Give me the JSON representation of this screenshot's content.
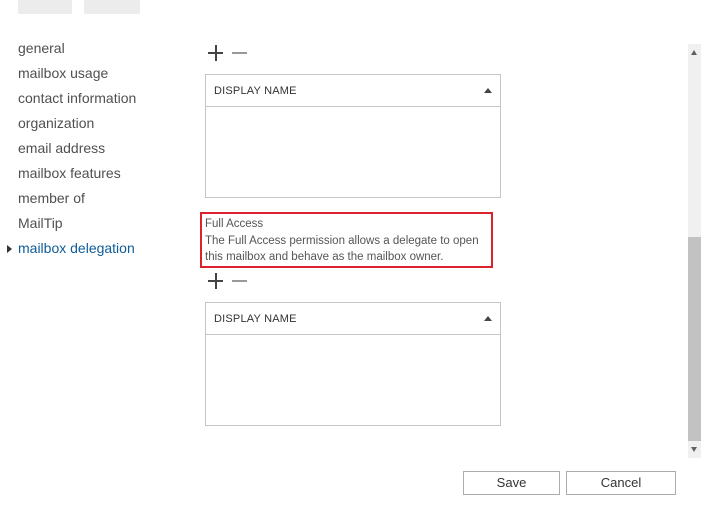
{
  "nav": {
    "items": [
      {
        "label": "general",
        "active": false
      },
      {
        "label": "mailbox usage",
        "active": false
      },
      {
        "label": "contact information",
        "active": false
      },
      {
        "label": "organization",
        "active": false
      },
      {
        "label": "email address",
        "active": false
      },
      {
        "label": "mailbox features",
        "active": false
      },
      {
        "label": "member of",
        "active": false
      },
      {
        "label": "MailTip",
        "active": false
      },
      {
        "label": "mailbox delegation",
        "active": true
      }
    ]
  },
  "icons": {
    "add": "plus-icon",
    "remove": "minus-icon",
    "sort": "sort-up-icon",
    "nav_selected": "caret-right-icon"
  },
  "grid1": {
    "header": "DISPLAY NAME"
  },
  "full_access": {
    "title": "Full Access",
    "description": "The Full Access permission allows a delegate to open this mailbox and behave as the mailbox owner."
  },
  "grid2": {
    "header": "DISPLAY NAME"
  },
  "footer": {
    "save_label": "Save",
    "cancel_label": "Cancel"
  },
  "colors": {
    "active_nav": "#0f5c98",
    "highlight_border": "#d9232e",
    "scroll_thumb": "#c2c2c2"
  }
}
